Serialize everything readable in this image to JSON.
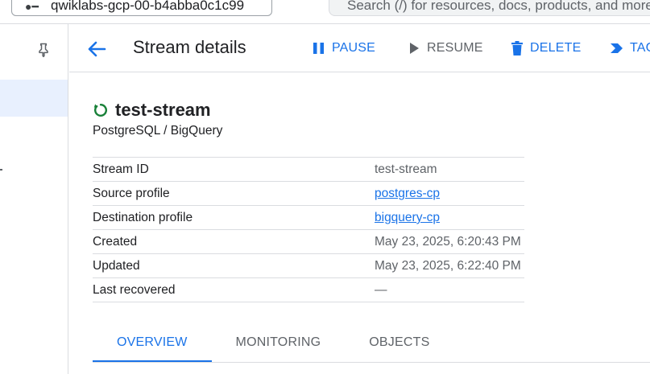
{
  "topbar": {
    "project_text": "qwiklabs-gcp-00-b4abba0c1c99",
    "project_icon": "project-dots-icon",
    "search_placeholder": "Search (/) for resources, docs, products, and more"
  },
  "rail": {
    "pin_icon": "pin-icon"
  },
  "header": {
    "title": "Stream details",
    "actions": [
      {
        "label": "PAUSE",
        "icon": "pause-icon",
        "state": "enabled"
      },
      {
        "label": "RESUME",
        "icon": "play-icon",
        "state": "disabled"
      },
      {
        "label": "DELETE",
        "icon": "trash-icon",
        "state": "enabled"
      },
      {
        "label": "TAG",
        "icon": "tag-icon",
        "state": "enabled"
      }
    ]
  },
  "stream": {
    "name": "test-stream",
    "status_icon": "running-status-icon",
    "subtitle": "PostgreSQL / BigQuery",
    "details": [
      {
        "key": "Stream ID",
        "value": "test-stream",
        "link": false
      },
      {
        "key": "Source profile",
        "value": "postgres-cp",
        "link": true
      },
      {
        "key": "Destination profile",
        "value": "bigquery-cp",
        "link": true
      },
      {
        "key": "Created",
        "value": "May 23, 2025, 6:20:43 PM",
        "link": false
      },
      {
        "key": "Updated",
        "value": "May 23, 2025, 6:22:40 PM",
        "link": false
      },
      {
        "key": "Last recovered",
        "value": "—",
        "link": false
      }
    ]
  },
  "tabs": [
    {
      "label": "OVERVIEW",
      "active": true
    },
    {
      "label": "MONITORING",
      "active": false
    },
    {
      "label": "OBJECTS",
      "active": false
    }
  ],
  "colors": {
    "accent": "#1a73e8",
    "status_ok": "#188038",
    "muted": "#5f6368",
    "divider": "#dadce0"
  }
}
